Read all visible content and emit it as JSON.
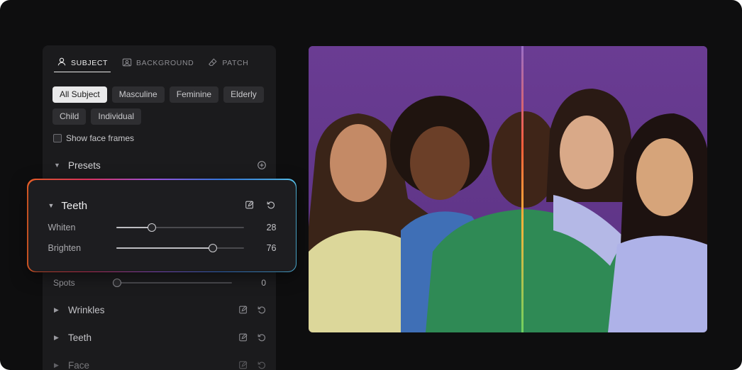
{
  "tabs": [
    {
      "label": "SUBJECT",
      "icon": "person-icon",
      "active": true
    },
    {
      "label": "BACKGROUND",
      "icon": "landscape-icon",
      "active": false
    },
    {
      "label": "PATCH",
      "icon": "eraser-icon",
      "active": false
    }
  ],
  "filters": [
    "All Subject",
    "Masculine",
    "Feminine",
    "Elderly",
    "Child",
    "Individual"
  ],
  "selected_filter": "All Subject",
  "show_face_frames": {
    "label": "Show face frames",
    "checked": false
  },
  "presets": {
    "label": "Presets",
    "icon": "plus-circle-icon"
  },
  "teeth_card": {
    "title": "Teeth",
    "edit_icon": "edit-icon",
    "reset_icon": "reset-icon",
    "sliders": [
      {
        "label": "Whiten",
        "value": "28",
        "level": 0.28
      },
      {
        "label": "Brighten",
        "value": "76",
        "level": 0.76
      }
    ]
  },
  "spots": {
    "label": "Spots",
    "value": "0",
    "level": 0
  },
  "sections": [
    {
      "label": "Wrinkles"
    },
    {
      "label": "Teeth"
    },
    {
      "label": "Face"
    }
  ],
  "colors": {
    "background": "#0e0e0f",
    "panel": "#1b1b1d",
    "photo_background": "#6d3f96",
    "highlight_gradient": [
      "#ff6a2b",
      "#ff3b6b",
      "#b060ff",
      "#3d8bff",
      "#5fd3ff"
    ]
  }
}
